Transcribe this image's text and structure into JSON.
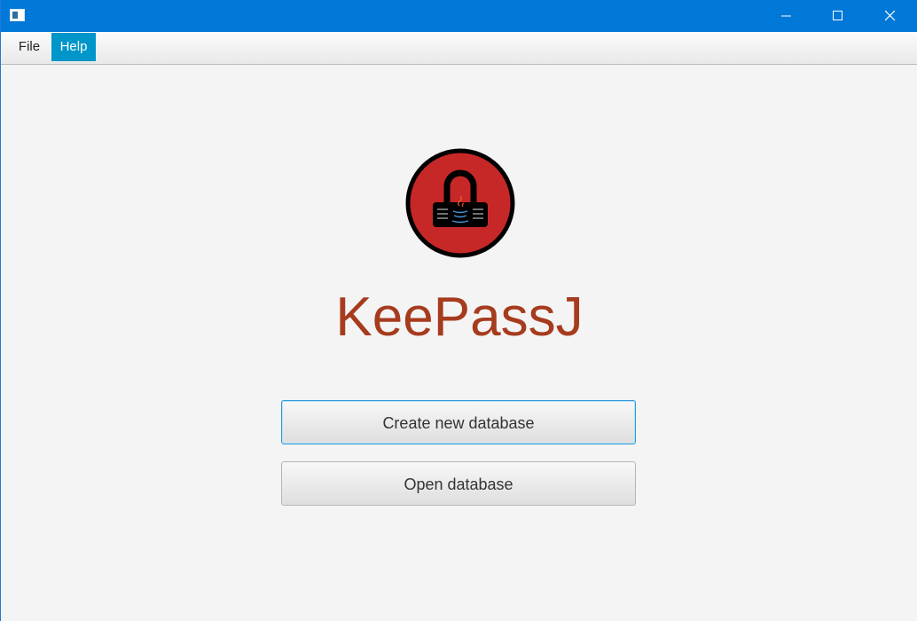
{
  "window": {
    "title": "",
    "controls": {
      "minimize_icon": "minimize-icon",
      "maximize_icon": "maximize-icon",
      "close_icon": "close-icon"
    }
  },
  "menubar": {
    "items": [
      {
        "label": "File",
        "active": false
      },
      {
        "label": "Help",
        "active": true
      }
    ],
    "active_color": "#0096c9"
  },
  "main": {
    "logo_icon": "padlock-logo-icon",
    "app_name": "KeePassJ",
    "buttons": {
      "create": "Create new database",
      "open": "Open database"
    }
  },
  "colors": {
    "titlebar": "#0078d7",
    "app_name": "#a63b1e",
    "logo_fill": "#c62828",
    "focus_border": "#2d9ad8"
  }
}
